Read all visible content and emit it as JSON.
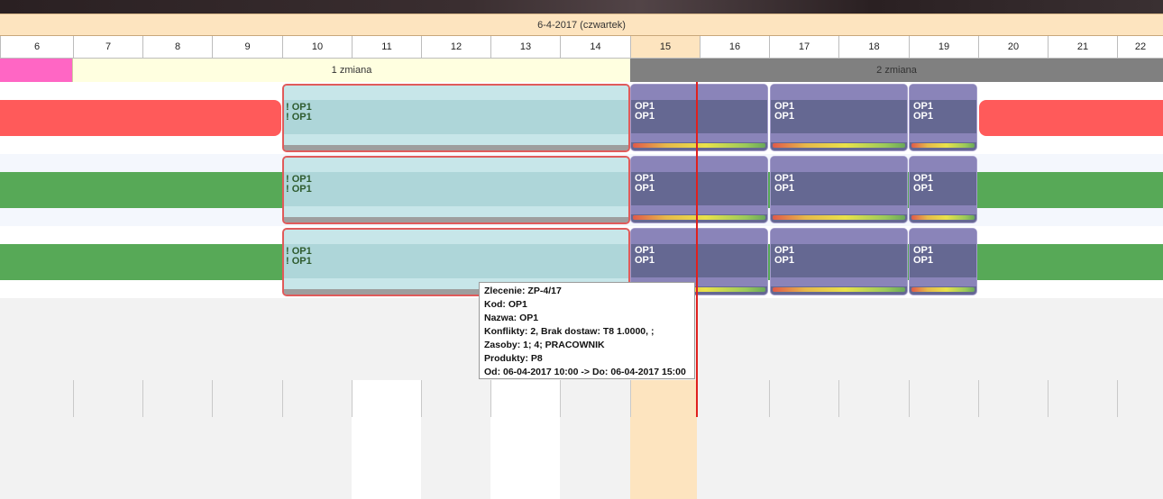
{
  "header": {
    "date_label": "6-4-2017 (czwartek)"
  },
  "hours": [
    "6",
    "7",
    "8",
    "9",
    "10",
    "11",
    "12",
    "13",
    "14",
    "15",
    "16",
    "17",
    "18",
    "19",
    "20",
    "21",
    "22"
  ],
  "highlight_hour": "15",
  "shifts": [
    {
      "label": "1 zmiana"
    },
    {
      "label": "2 zmiana"
    }
  ],
  "tasks": {
    "row1": {
      "cyan_label": "! OP1\n! OP1",
      "purple_label": "OP1\nOP1"
    },
    "row2": {
      "cyan_label": "! OP1\n! OP1",
      "purple_label": "OP1\nOP1"
    },
    "row3": {
      "cyan_label": "! OP1\n! OP1",
      "purple_label": "OP1\nOP1"
    }
  },
  "tooltip": {
    "zlecenie": "Zlecenie: ZP-4/17",
    "kod": "Kod: OP1",
    "nazwa": "Nazwa: OP1",
    "konflikty": "Konflikty: 2, Brak dostaw: T8 1.0000, ;",
    "zasoby": "Zasoby: 1; 4; PRACOWNIK",
    "produkty": "Produkty: P8",
    "zakres": "Od: 06-04-2017 10:00 -> Do: 06-04-2017 15:00"
  },
  "colors": {
    "row1_bar": "#ff5a5a",
    "row2_bar": "#57a957",
    "row3_bar": "#57a957",
    "shift1": "#ffffe0",
    "shift2": "#808080",
    "pre_shift": "#ff66c4",
    "now_line": "#e0201e"
  }
}
